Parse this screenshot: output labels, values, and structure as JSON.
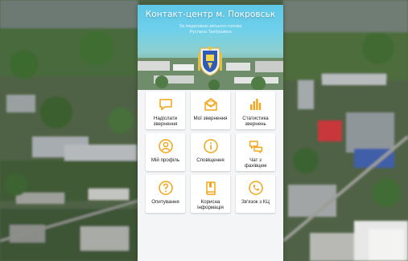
{
  "app": {
    "title": "Контакт-центр м. Покровськ",
    "subtitle": "За ініціативою міського голови\nРуслана Требушкіна"
  },
  "colors": {
    "accent": "#f2a515",
    "header_sky": "#5fc7e8",
    "tile_bg": "#ffffff",
    "panel_bg": "#f4f5f7"
  },
  "tiles": [
    {
      "label": "Надіслати\nзвернення",
      "icon": "chat-bubble-icon"
    },
    {
      "label": "Мої звернення",
      "icon": "envelope-open-icon"
    },
    {
      "label": "Статистика\nзвернень",
      "icon": "bar-chart-icon"
    },
    {
      "label": "Мій профіль",
      "icon": "user-circle-icon"
    },
    {
      "label": "Сповіщення",
      "icon": "info-circle-icon"
    },
    {
      "label": "Чат з\nфахівцем",
      "icon": "chat-bubbles-icon"
    },
    {
      "label": "Опитування",
      "icon": "question-circle-icon"
    },
    {
      "label": "Корисна\nінформація",
      "icon": "book-icon"
    },
    {
      "label": "Зв'язок з КЦ",
      "icon": "phone-circle-icon"
    }
  ]
}
